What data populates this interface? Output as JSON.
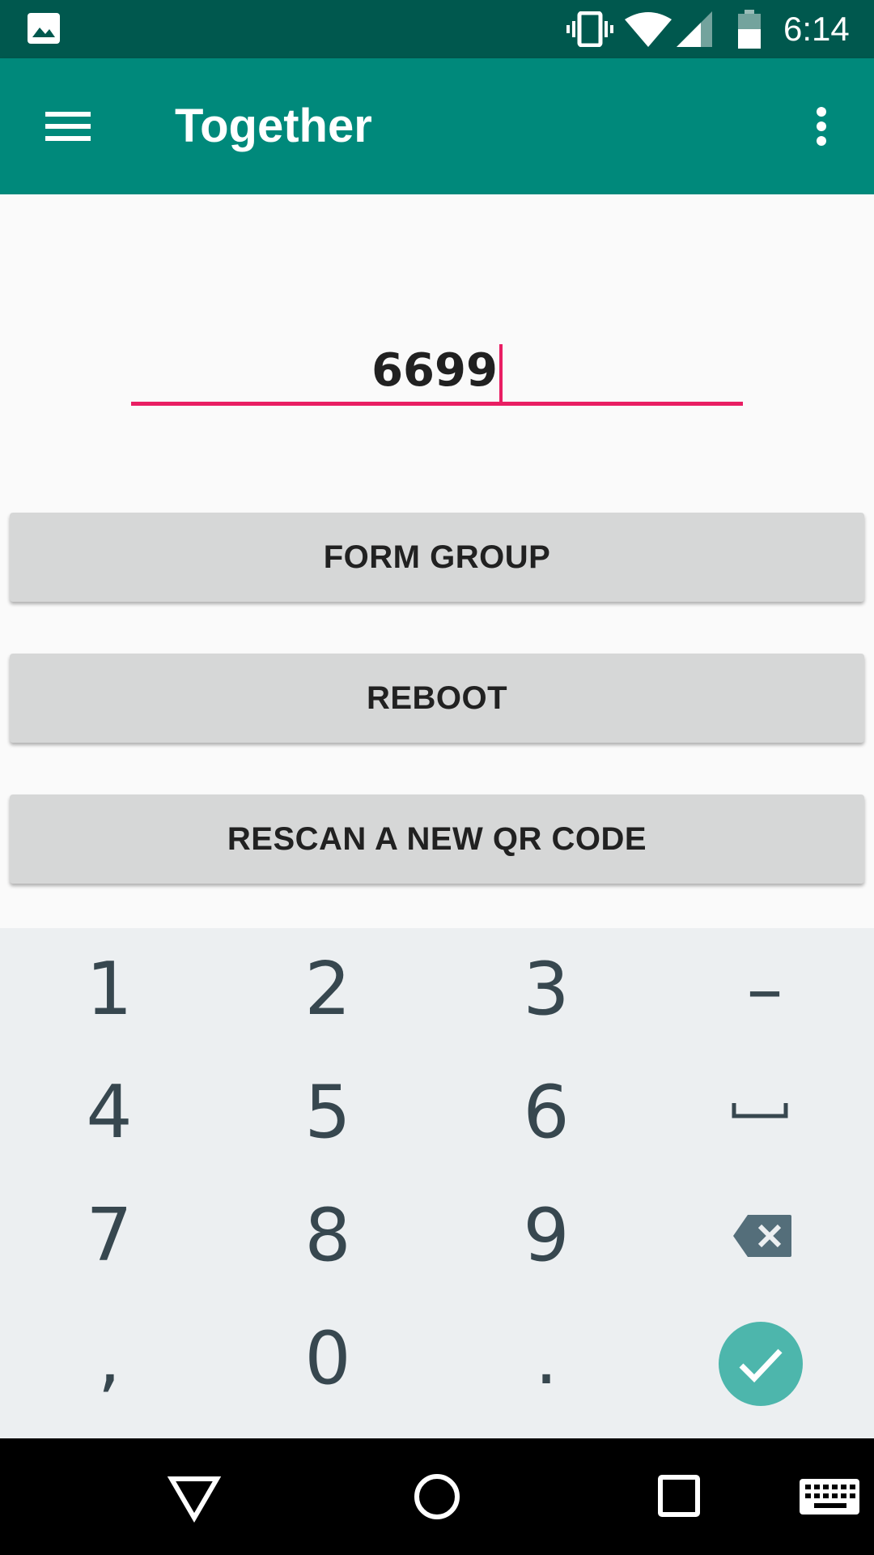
{
  "status_bar": {
    "time": "6:14",
    "icons": [
      "gallery-icon",
      "vibrate-icon",
      "wifi-icon",
      "signal-icon",
      "battery-icon"
    ]
  },
  "toolbar": {
    "title": "Together",
    "menu_icon": "hamburger-menu-icon",
    "overflow_icon": "more-vert-icon",
    "color": "#00897B"
  },
  "form": {
    "code_value": "6699",
    "accent_color": "#E91E63"
  },
  "buttons": {
    "form_group": "FORM GROUP",
    "reboot": "REBOOT",
    "rescan": "RESCAN A NEW QR CODE"
  },
  "keyboard": {
    "rows": [
      [
        "1",
        "2",
        "3",
        "–"
      ],
      [
        "4",
        "5",
        "6",
        "space"
      ],
      [
        "7",
        "8",
        "9",
        "backspace"
      ],
      [
        ",",
        "0",
        ".",
        "done"
      ]
    ],
    "done_color": "#4DB6AC"
  },
  "nav_bar": {
    "icons": [
      "back-icon",
      "home-icon",
      "recents-icon",
      "keyboard-icon"
    ]
  }
}
